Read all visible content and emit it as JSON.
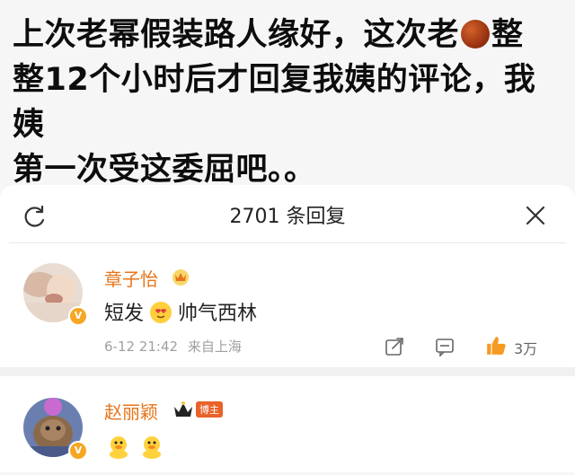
{
  "post": {
    "line1_a": "上次老幂假装路人缘好，这次老",
    "line1_b": "整",
    "line2": "整12个小时后才回复我姨的评论，我姨",
    "line3": "第一次受这委屈吧。。"
  },
  "panel": {
    "title": "2701 条回复"
  },
  "comments": [
    {
      "username": "章子怡",
      "text_a": "短发",
      "text_b": "帅气西林",
      "time": "6-12 21:42",
      "location": "来自上海",
      "likes": "3万"
    },
    {
      "username": "赵丽颖",
      "tag": "博主"
    }
  ],
  "colors": {
    "username": "#e8751a",
    "like_icon": "#f59a23",
    "chestnut": "#9c3412"
  }
}
